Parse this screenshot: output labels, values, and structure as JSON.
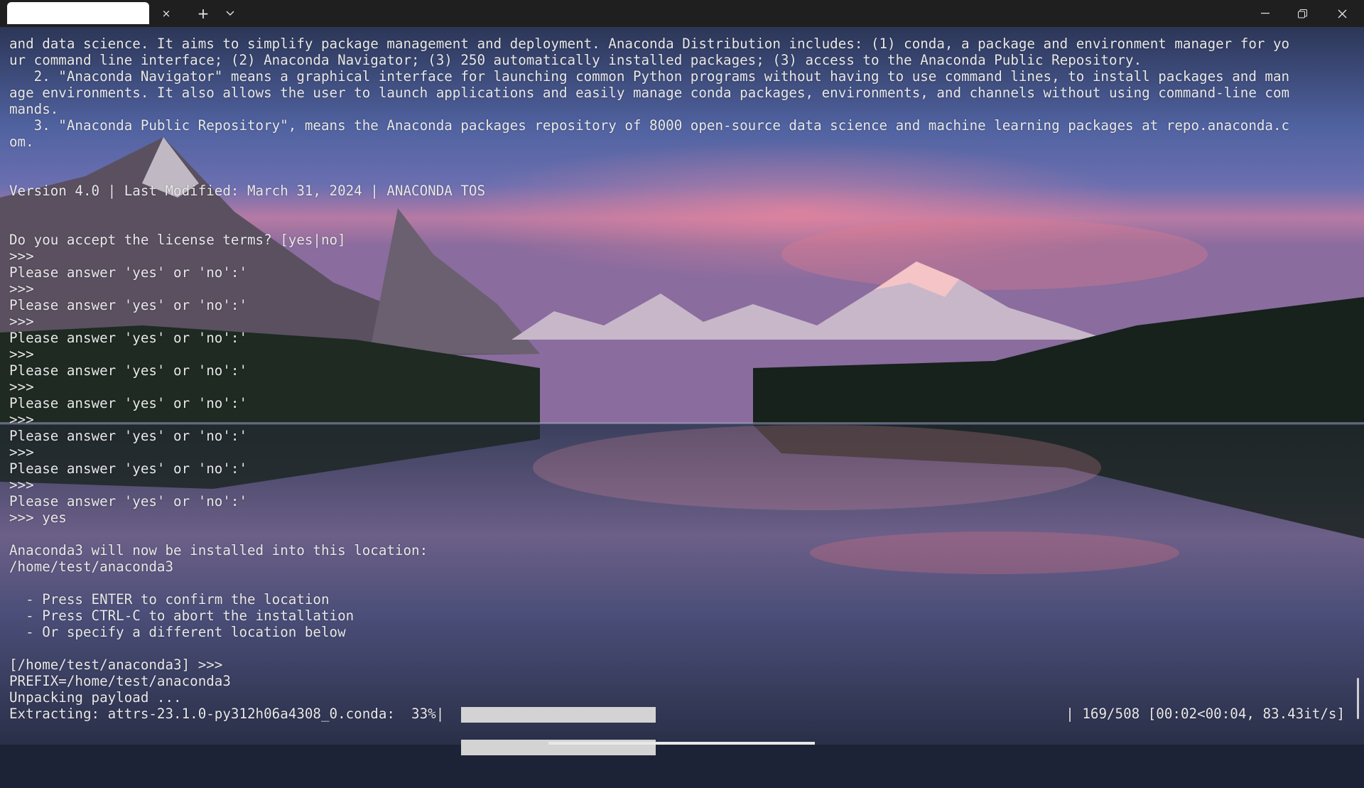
{
  "window": {
    "tab_title": "",
    "tab_close_icon": "×",
    "new_tab_icon": "+",
    "dropdown_icon": "⌄",
    "minimize_icon": "—",
    "maximize_icon": "❐",
    "close_icon": "✕"
  },
  "terminal": {
    "lines": [
      "and data science. It aims to simplify package management and deployment. Anaconda Distribution includes: (1) conda, a package and environment manager for yo",
      "ur command line interface; (2) Anaconda Navigator; (3) 250 automatically installed packages; (3) access to the Anaconda Public Repository.",
      "   2. \"Anaconda Navigator\" means a graphical interface for launching common Python programs without having to use command lines, to install packages and man",
      "age environments. It also allows the user to launch applications and easily manage conda packages, environments, and channels without using command-line com",
      "mands.",
      "   3. \"Anaconda Public Repository\", means the Anaconda packages repository of 8000 open-source data science and machine learning packages at repo.anaconda.c",
      "om.",
      "",
      "",
      "Version 4.0 | Last Modified: March 31, 2024 | ANACONDA TOS",
      "",
      "",
      "Do you accept the license terms? [yes|no]",
      ">>>",
      "Please answer 'yes' or 'no':'",
      ">>>",
      "Please answer 'yes' or 'no':'",
      ">>>",
      "Please answer 'yes' or 'no':'",
      ">>>",
      "Please answer 'yes' or 'no':'",
      ">>>",
      "Please answer 'yes' or 'no':'",
      ">>>",
      "Please answer 'yes' or 'no':'",
      ">>>",
      "Please answer 'yes' or 'no':'",
      ">>>",
      "Please answer 'yes' or 'no':'",
      ">>> yes",
      "",
      "Anaconda3 will now be installed into this location:",
      "/home/test/anaconda3",
      "",
      "  - Press ENTER to confirm the location",
      "  - Press CTRL-C to abort the installation",
      "  - Or specify a different location below",
      "",
      "[/home/test/anaconda3] >>>",
      "PREFIX=/home/test/anaconda3",
      "Unpacking payload ..."
    ],
    "progress": {
      "label": "Extracting: attrs-23.1.0-py312h06a4308_0.conda:  33%|",
      "percent": 33,
      "stats": "| 169/508 [00:02<00:04, 83.43it/s]"
    }
  }
}
